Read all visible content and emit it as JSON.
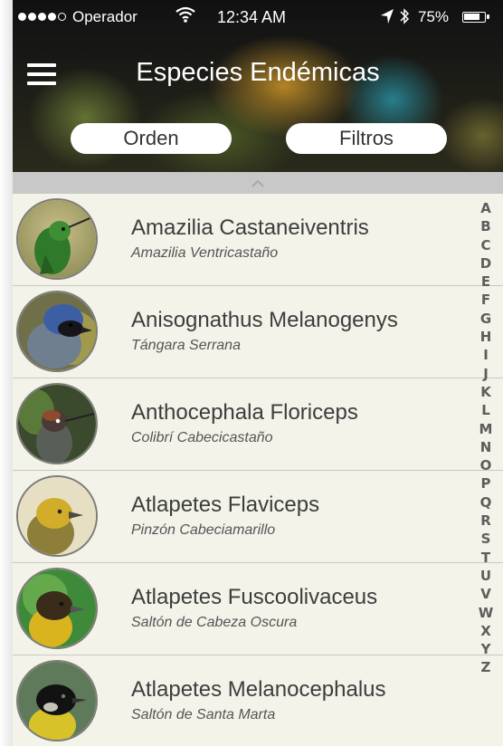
{
  "status_bar": {
    "carrier": "Operador",
    "time": "12:34 AM",
    "battery": "75%",
    "wifi_icon": "wifi-icon",
    "location_icon": "location-arrow-icon",
    "bluetooth_icon": "bluetooth-icon"
  },
  "header": {
    "title": "Especies Endémicas",
    "menu_icon": "hamburger-menu-icon",
    "order_label": "Orden",
    "filters_label": "Filtros"
  },
  "species": [
    {
      "scientific": "Amazilia Castaneiventris",
      "common": "Amazilia Ventricastaño"
    },
    {
      "scientific": "Anisognathus Melanogenys",
      "common": "Tángara Serrana"
    },
    {
      "scientific": "Anthocephala Floriceps",
      "common": "Colibrí Cabecicastaño"
    },
    {
      "scientific": "Atlapetes Flaviceps",
      "common": "Pinzón Cabeciamarillo"
    },
    {
      "scientific": "Atlapetes Fuscoolivaceus",
      "common": "Saltón de Cabeza Oscura"
    },
    {
      "scientific": "Atlapetes Melanocephalus",
      "common": "Saltón de Santa Marta"
    }
  ],
  "alphabet": [
    "A",
    "B",
    "C",
    "D",
    "E",
    "F",
    "G",
    "H",
    "I",
    "J",
    "K",
    "L",
    "M",
    "N",
    "O",
    "P",
    "Q",
    "R",
    "S",
    "T",
    "U",
    "V",
    "W",
    "X",
    "Y",
    "Z"
  ],
  "colors": {
    "list_bg": "#f3f3ea",
    "pill_bg": "#ffffff",
    "index_text": "#5d5d5d"
  }
}
